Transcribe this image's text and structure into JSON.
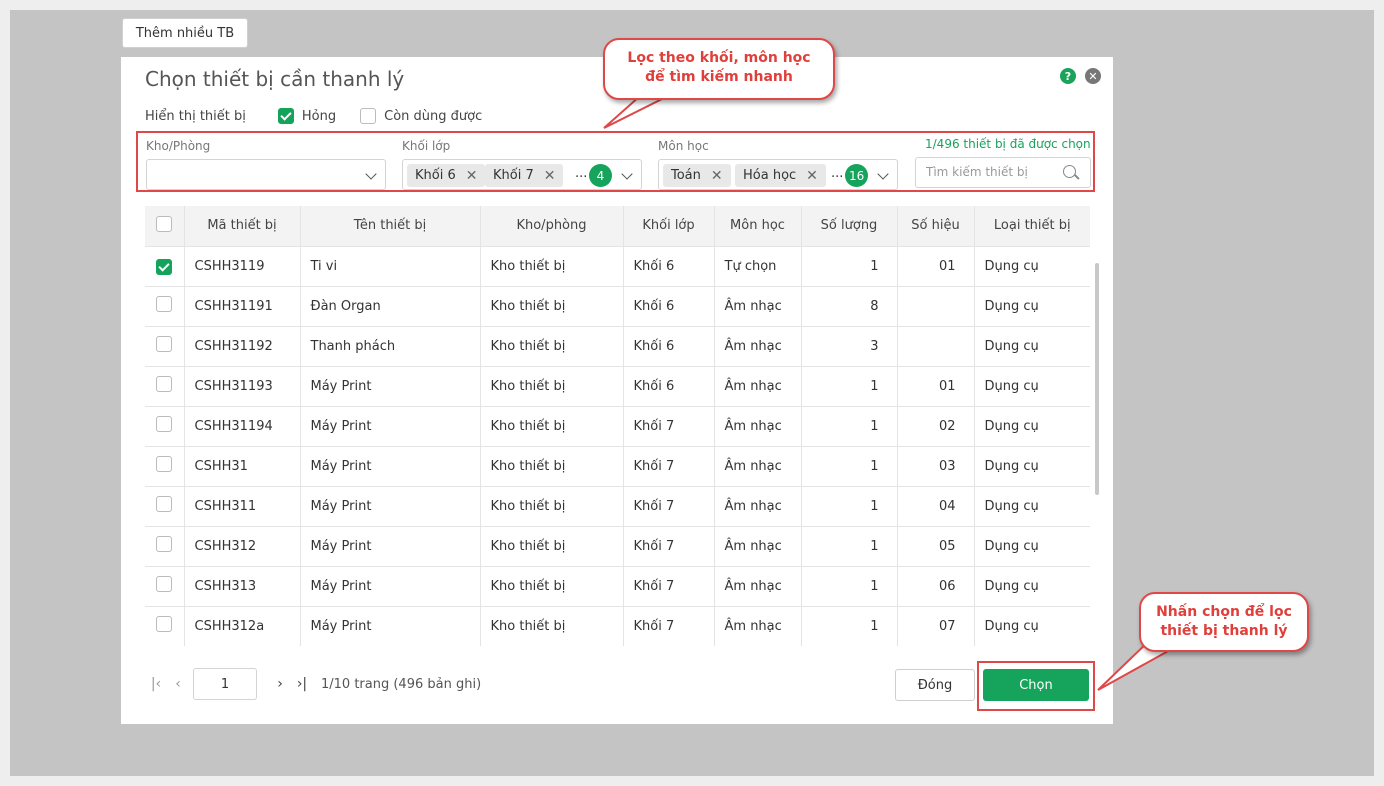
{
  "top_button": {
    "label": "Thêm nhiều TB"
  },
  "dialog": {
    "title": "Chọn thiết bị cần thanh lý",
    "help_glyph": "?",
    "close_glyph": "✕",
    "show": {
      "label": "Hiển thị thiết bị",
      "options": [
        {
          "label": "Hỏng",
          "checked": true
        },
        {
          "label": "Còn dùng được",
          "checked": false
        }
      ]
    },
    "filters": {
      "kho": {
        "label": "Kho/Phòng",
        "value": ""
      },
      "khoi": {
        "label": "Khối lớp",
        "tags": [
          "Khối 6",
          "Khối 7"
        ],
        "more": "...",
        "count": "4"
      },
      "mon": {
        "label": "Môn học",
        "tags": [
          "Toán",
          "Hóa học"
        ],
        "more": "...",
        "count": "16"
      },
      "selected_info": "1/496 thiết bị đã được chọn",
      "search_placeholder": "Tìm kiếm thiết bị"
    },
    "table": {
      "headers": [
        "Mã thiết bị",
        "Tên thiết bị",
        "Kho/phòng",
        "Khối lớp",
        "Môn học",
        "Số lượng",
        "Số hiệu",
        "Loại thiết bị"
      ],
      "rows": [
        {
          "checked": true,
          "cells": [
            "CSHH3119",
            "Ti vi",
            "Kho thiết bị",
            "Khối 6",
            "Tự chọn",
            "1",
            "01",
            "Dụng cụ"
          ]
        },
        {
          "checked": false,
          "cells": [
            "CSHH31191",
            "Đàn Organ",
            "Kho thiết bị",
            "Khối 6",
            "Âm nhạc",
            "8",
            "",
            "Dụng cụ"
          ]
        },
        {
          "checked": false,
          "cells": [
            "CSHH31192",
            "Thanh phách",
            "Kho thiết bị",
            "Khối 6",
            "Âm nhạc",
            "3",
            "",
            "Dụng cụ"
          ]
        },
        {
          "checked": false,
          "cells": [
            "CSHH31193",
            "Máy Print",
            "Kho thiết bị",
            "Khối 6",
            "Âm nhạc",
            "1",
            "01",
            "Dụng cụ"
          ]
        },
        {
          "checked": false,
          "cells": [
            "CSHH31194",
            "Máy Print",
            "Kho thiết bị",
            "Khối 7",
            "Âm nhạc",
            "1",
            "02",
            "Dụng cụ"
          ]
        },
        {
          "checked": false,
          "cells": [
            "CSHH31",
            "Máy Print",
            "Kho thiết bị",
            "Khối 7",
            "Âm nhạc",
            "1",
            "03",
            "Dụng cụ"
          ]
        },
        {
          "checked": false,
          "cells": [
            "CSHH311",
            "Máy Print",
            "Kho thiết bị",
            "Khối 7",
            "Âm nhạc",
            "1",
            "04",
            "Dụng cụ"
          ]
        },
        {
          "checked": false,
          "cells": [
            "CSHH312",
            "Máy Print",
            "Kho thiết bị",
            "Khối 7",
            "Âm nhạc",
            "1",
            "05",
            "Dụng cụ"
          ]
        },
        {
          "checked": false,
          "cells": [
            "CSHH313",
            "Máy Print",
            "Kho thiết bị",
            "Khối 7",
            "Âm nhạc",
            "1",
            "06",
            "Dụng cụ"
          ]
        },
        {
          "checked": false,
          "cells": [
            "CSHH312a",
            "Máy Print",
            "Kho thiết bị",
            "Khối 7",
            "Âm nhạc",
            "1",
            "07",
            "Dụng cụ"
          ]
        }
      ]
    },
    "pager": {
      "page": "1",
      "info": "1/10 trang (496 bản ghi)"
    },
    "buttons": {
      "close": "Đóng",
      "choose": "Chọn"
    }
  },
  "callouts": {
    "filter": {
      "line1": "Lọc theo khối, môn học",
      "line2": "để tìm kiếm nhanh"
    },
    "choose": {
      "line1": "Nhấn chọn để lọc",
      "line2": "thiết bị thanh lý"
    }
  },
  "colors": {
    "accent": "#16a35b",
    "highlight": "#e04848",
    "backdrop": "#c4c4c4"
  }
}
